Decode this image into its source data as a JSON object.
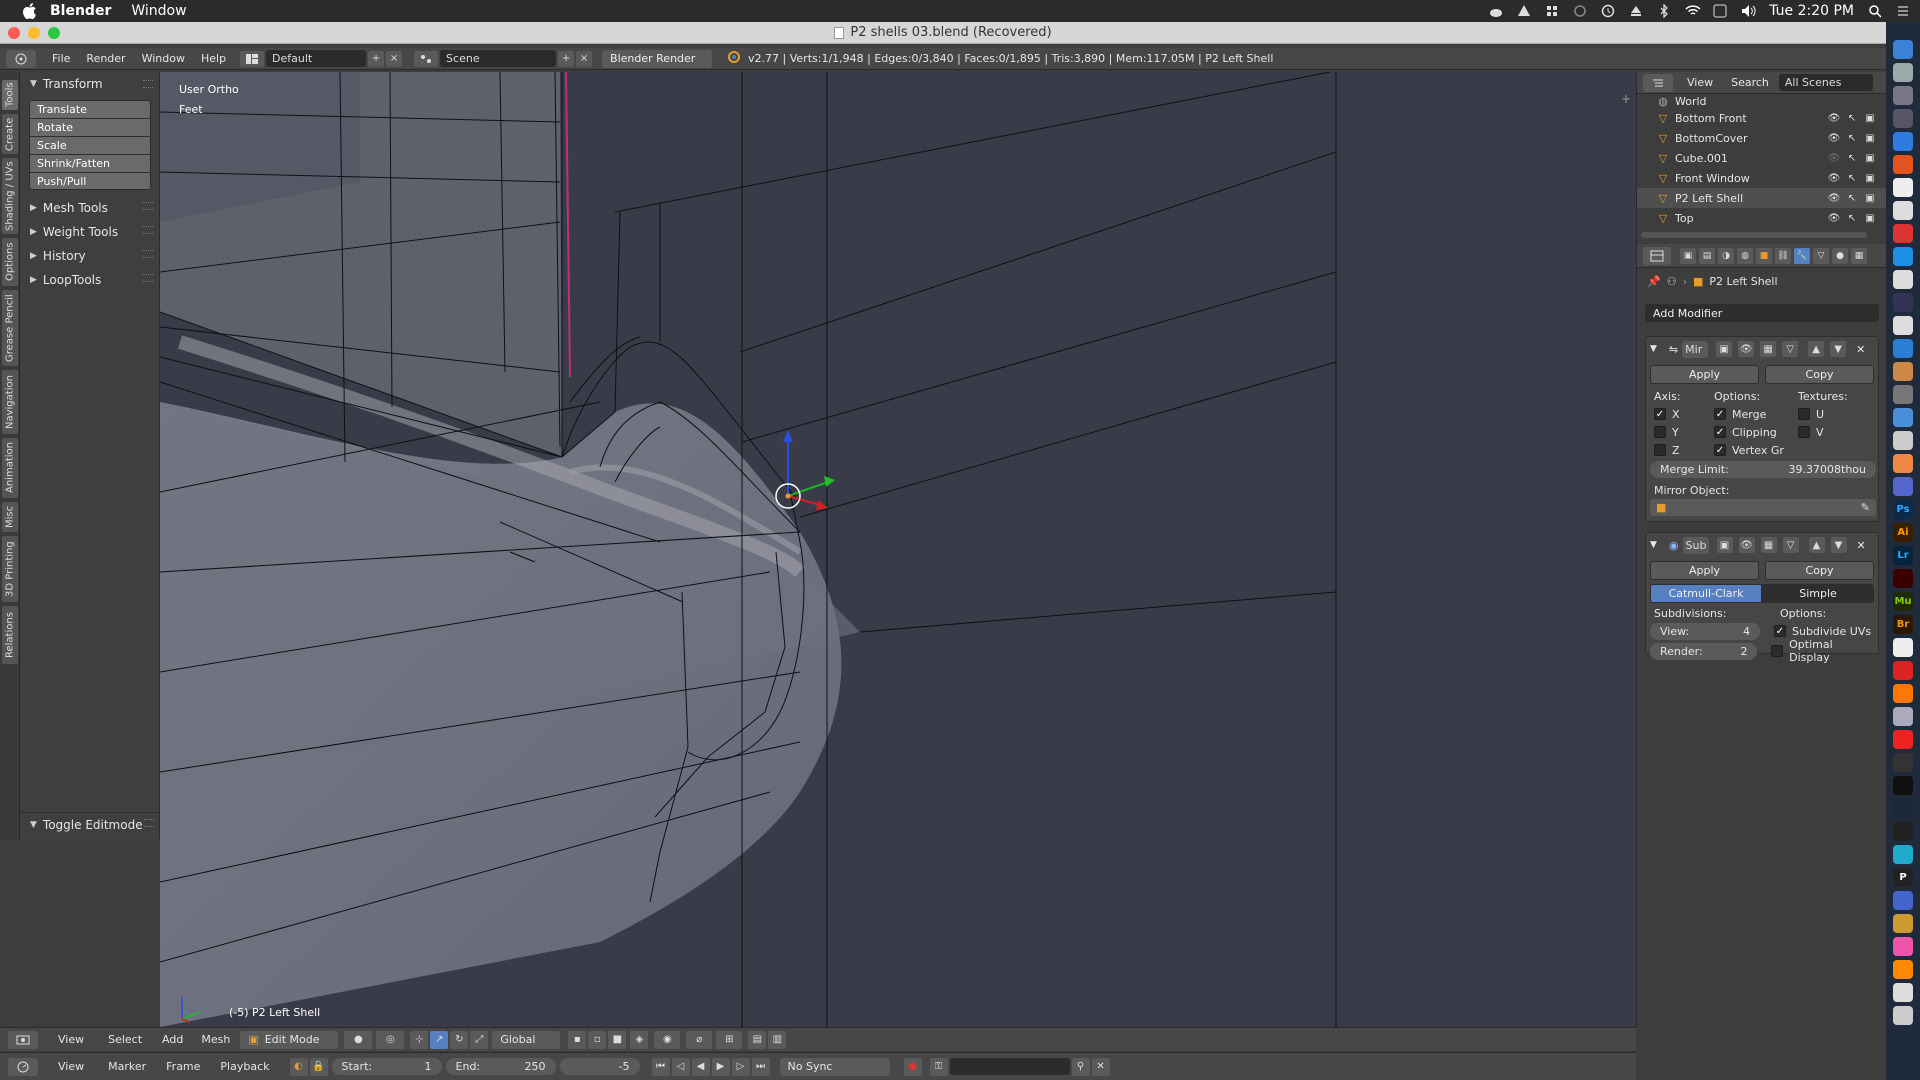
{
  "mac_menubar": {
    "app_name": "Blender",
    "menus": [
      "Window"
    ],
    "clock": "Tue 2:20 PM"
  },
  "window": {
    "title": "P2 shells 03.blend (Recovered)"
  },
  "info_header": {
    "menus": [
      "File",
      "Render",
      "Window",
      "Help"
    ],
    "screen_layout": "Default",
    "scene": "Scene",
    "render_engine": "Blender Render",
    "stats": "v2.77 | Verts:1/1,948 | Edges:0/3,840 | Faces:0/1,895 | Tris:3,890 | Mem:117.05M | P2 Left Shell"
  },
  "left_tabs": [
    "Tools",
    "Create",
    "Shading / UVs",
    "Options",
    "Grease Pencil",
    "Navigation",
    "Animation",
    "Misc",
    "3D Printing",
    "Relations"
  ],
  "toolshelf": {
    "transform_title": "Transform",
    "transform_buttons": [
      "Translate",
      "Rotate",
      "Scale",
      "Shrink/Fatten",
      "Push/Pull"
    ],
    "collapsed_panels": [
      "Mesh Tools",
      "Weight Tools",
      "History",
      "LoopTools"
    ],
    "toggle_editmode": "Toggle Editmode"
  },
  "viewport": {
    "view_name": "User Ortho",
    "units": "Feet",
    "object_label": "(-5) P2 Left Shell"
  },
  "viewport_header": {
    "menus": [
      "View",
      "Select",
      "Add",
      "Mesh"
    ],
    "mode": "Edit Mode",
    "orientation": "Global"
  },
  "timeline": {
    "menus": [
      "View",
      "Marker",
      "Frame",
      "Playback"
    ],
    "start_label": "Start:",
    "start_value": "1",
    "end_label": "End:",
    "end_value": "250",
    "current_frame": "-5",
    "sync": "No Sync"
  },
  "outliner": {
    "menus": [
      "View",
      "Search"
    ],
    "scenes_selector": "All Scenes",
    "items": [
      {
        "name": "World",
        "selected": false
      },
      {
        "name": "Bottom Front",
        "selected": false
      },
      {
        "name": "BottomCover",
        "selected": false
      },
      {
        "name": "Cube.001",
        "selected": false
      },
      {
        "name": "Front Window",
        "selected": false
      },
      {
        "name": "P2 Left Shell",
        "selected": true
      },
      {
        "name": "Top",
        "selected": false
      }
    ]
  },
  "properties": {
    "object_name": "P2 Left Shell",
    "add_modifier": "Add Modifier",
    "mirror": {
      "name": "Mir",
      "apply": "Apply",
      "copy": "Copy",
      "axis_label": "Axis:",
      "options_label": "Options:",
      "textures_label": "Textures:",
      "axis": [
        {
          "label": "X",
          "checked": true
        },
        {
          "label": "Y",
          "checked": false
        },
        {
          "label": "Z",
          "checked": false
        }
      ],
      "options": [
        {
          "label": "Merge",
          "checked": true
        },
        {
          "label": "Clipping",
          "checked": true
        },
        {
          "label": "Vertex Gr",
          "checked": true
        }
      ],
      "textures": [
        {
          "label": "U",
          "checked": false
        },
        {
          "label": "V",
          "checked": false
        }
      ],
      "merge_limit_label": "Merge Limit:",
      "merge_limit_value": "39.37008thou",
      "mirror_object_label": "Mirror Object:"
    },
    "subsurf": {
      "name": "Sub",
      "apply": "Apply",
      "copy": "Copy",
      "type_catmull": "Catmull-Clark",
      "type_simple": "Simple",
      "subdivisions_label": "Subdivisions:",
      "options_label": "Options:",
      "view_label": "View:",
      "view_value": "4",
      "render_label": "Render:",
      "render_value": "2",
      "subdivide_uvs": "Subdivide UVs",
      "subdivide_uvs_checked": true,
      "optimal_display": "Optimal Display",
      "optimal_display_checked": false
    }
  },
  "colors": {
    "viewport_bg": "#393c48",
    "active_blue": "#5680c2",
    "object_orange": "#e89b2d"
  }
}
